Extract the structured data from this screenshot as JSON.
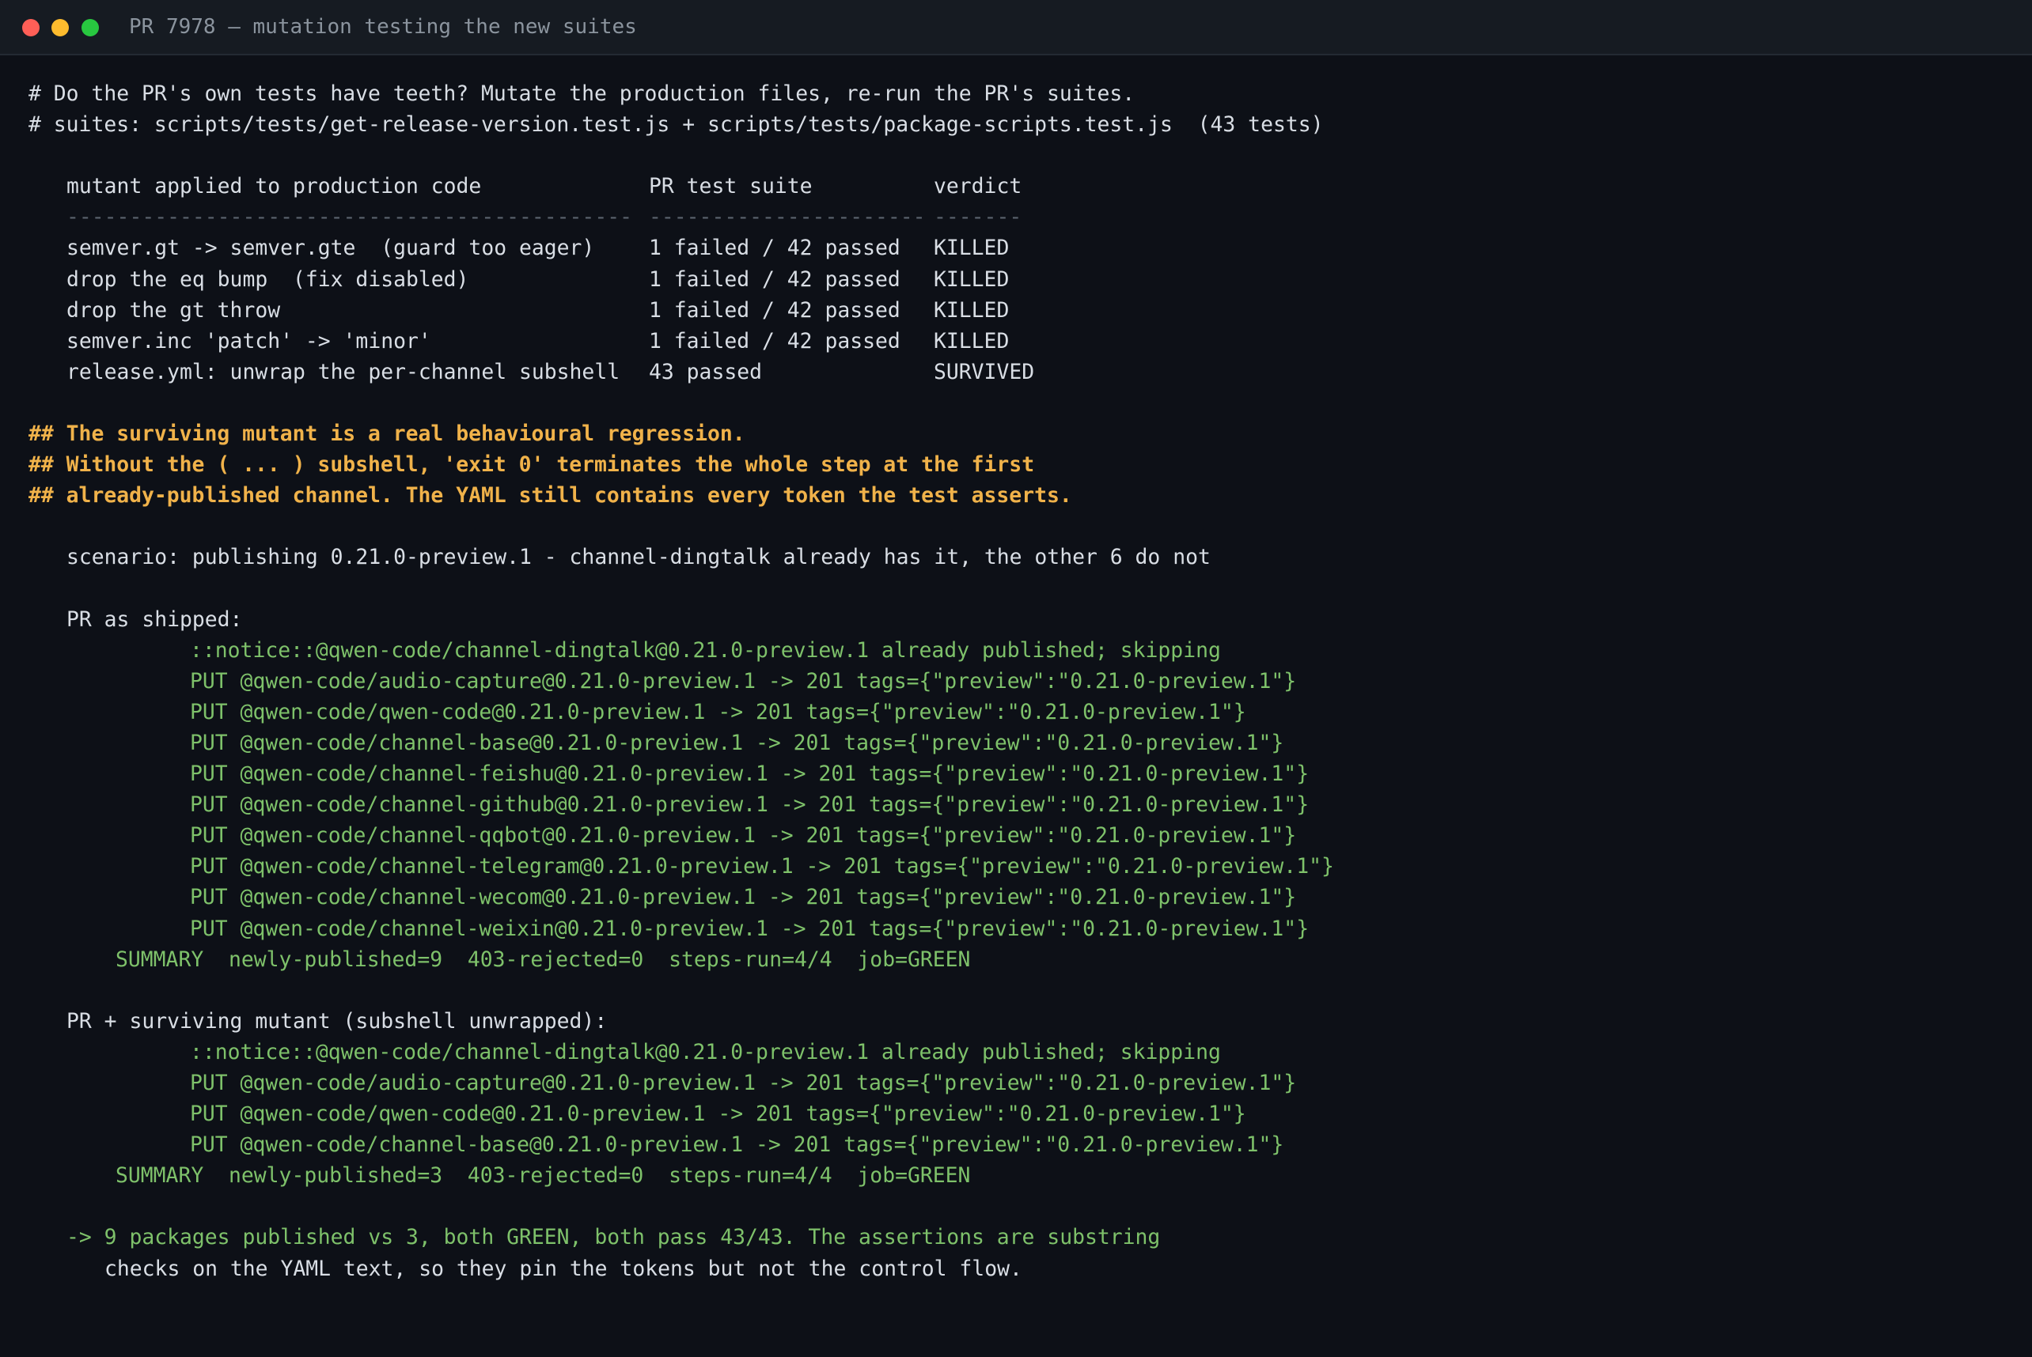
{
  "window": {
    "title": "PR 7978 — mutation testing the new suites"
  },
  "intro": [
    "# Do the PR's own tests have teeth? Mutate the production files, re-run the PR's suites.",
    "# suites: scripts/tests/get-release-version.test.js + scripts/tests/package-scripts.test.js  (43 tests)"
  ],
  "table": {
    "headers": [
      "mutant applied to production code",
      "PR test suite",
      "verdict"
    ],
    "separators": [
      "---------------------------------------------",
      "----------------------",
      "-------"
    ],
    "rows": [
      {
        "mutant": "semver.gt -> semver.gte  (guard too eager)",
        "suite": "1 failed / 42 passed",
        "verdict": "KILLED"
      },
      {
        "mutant": "drop the eq bump  (fix disabled)",
        "suite": "1 failed / 42 passed",
        "verdict": "KILLED"
      },
      {
        "mutant": "drop the gt throw",
        "suite": "1 failed / 42 passed",
        "verdict": "KILLED"
      },
      {
        "mutant": "semver.inc 'patch' -> 'minor'",
        "suite": "1 failed / 42 passed",
        "verdict": "KILLED"
      },
      {
        "mutant": "release.yml: unwrap the per-channel subshell",
        "suite": "43 passed",
        "verdict": "SURVIVED"
      }
    ]
  },
  "warning": [
    "## The surviving mutant is a real behavioural regression.",
    "## Without the ( ... ) subshell, 'exit 0' terminates the whole step at the first",
    "## already-published channel. The YAML still contains every token the test asserts."
  ],
  "scenario": "scenario: publishing 0.21.0-preview.1 - channel-dingtalk already has it, the other 6 do not",
  "shipped": {
    "label": "PR as shipped:",
    "lines": [
      "::notice::@qwen-code/channel-dingtalk@0.21.0-preview.1 already published; skipping",
      "PUT @qwen-code/audio-capture@0.21.0-preview.1 -> 201 tags={\"preview\":\"0.21.0-preview.1\"}",
      "PUT @qwen-code/qwen-code@0.21.0-preview.1 -> 201 tags={\"preview\":\"0.21.0-preview.1\"}",
      "PUT @qwen-code/channel-base@0.21.0-preview.1 -> 201 tags={\"preview\":\"0.21.0-preview.1\"}",
      "PUT @qwen-code/channel-feishu@0.21.0-preview.1 -> 201 tags={\"preview\":\"0.21.0-preview.1\"}",
      "PUT @qwen-code/channel-github@0.21.0-preview.1 -> 201 tags={\"preview\":\"0.21.0-preview.1\"}",
      "PUT @qwen-code/channel-qqbot@0.21.0-preview.1 -> 201 tags={\"preview\":\"0.21.0-preview.1\"}",
      "PUT @qwen-code/channel-telegram@0.21.0-preview.1 -> 201 tags={\"preview\":\"0.21.0-preview.1\"}",
      "PUT @qwen-code/channel-wecom@0.21.0-preview.1 -> 201 tags={\"preview\":\"0.21.0-preview.1\"}",
      "PUT @qwen-code/channel-weixin@0.21.0-preview.1 -> 201 tags={\"preview\":\"0.21.0-preview.1\"}"
    ],
    "summary": "SUMMARY  newly-published=9  403-rejected=0  steps-run=4/4  job=GREEN"
  },
  "mutant": {
    "label": "PR + surviving mutant (subshell unwrapped):",
    "lines": [
      "::notice::@qwen-code/channel-dingtalk@0.21.0-preview.1 already published; skipping",
      "PUT @qwen-code/audio-capture@0.21.0-preview.1 -> 201 tags={\"preview\":\"0.21.0-preview.1\"}",
      "PUT @qwen-code/qwen-code@0.21.0-preview.1 -> 201 tags={\"preview\":\"0.21.0-preview.1\"}",
      "PUT @qwen-code/channel-base@0.21.0-preview.1 -> 201 tags={\"preview\":\"0.21.0-preview.1\"}"
    ],
    "summary": "SUMMARY  newly-published=3  403-rejected=0  steps-run=4/4  job=GREEN"
  },
  "conclusion": [
    "-> 9 packages published vs 3, both GREEN, both pass 43/43. The assertions are substring",
    "checks on the YAML text, so they pin the tokens but not the control flow."
  ],
  "colors": {
    "background": "#0d1017",
    "titlebar": "#161b22",
    "text": "#d9dee5",
    "warning": "#f0b24a",
    "success": "#7ec16a",
    "muted": "#5a626d"
  }
}
